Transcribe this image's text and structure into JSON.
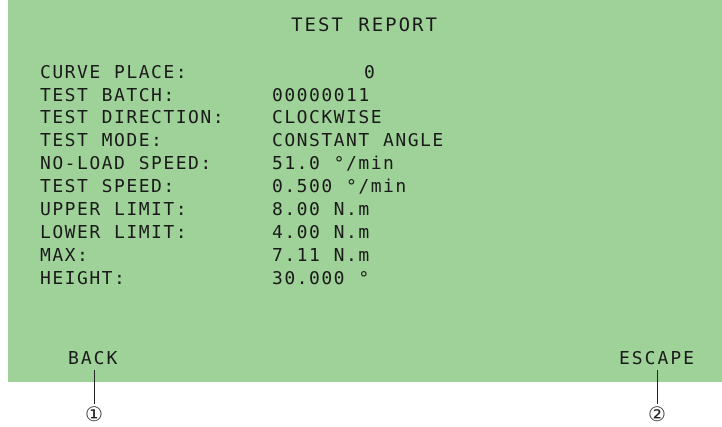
{
  "report": {
    "title": "TEST REPORT",
    "rows": [
      {
        "label": "CURVE PLACE:",
        "value": "0"
      },
      {
        "label": "TEST BATCH:",
        "value": "00000011"
      },
      {
        "label": "TEST DIRECTION:",
        "value": "CLOCKWISE"
      },
      {
        "label": "TEST MODE:",
        "value": "CONSTANT ANGLE"
      },
      {
        "label": "NO-LOAD SPEED:",
        "value": "51.0  °/min"
      },
      {
        "label": "TEST SPEED:",
        "value": "0.500 °/min"
      },
      {
        "label": "UPPER LIMIT:",
        "value": "8.00 N.m"
      },
      {
        "label": "LOWER LIMIT:",
        "value": "4.00 N.m"
      },
      {
        "label": "MAX:",
        "value": "7.11 N.m"
      },
      {
        "label": "HEIGHT:",
        "value": "30.000 °"
      }
    ]
  },
  "softkeys": {
    "back": "BACK",
    "escape": "ESCAPE"
  },
  "callouts": {
    "one": "①",
    "two": "②"
  },
  "colors": {
    "screen_background": "#9fd298",
    "text": "#1a1a1a"
  }
}
